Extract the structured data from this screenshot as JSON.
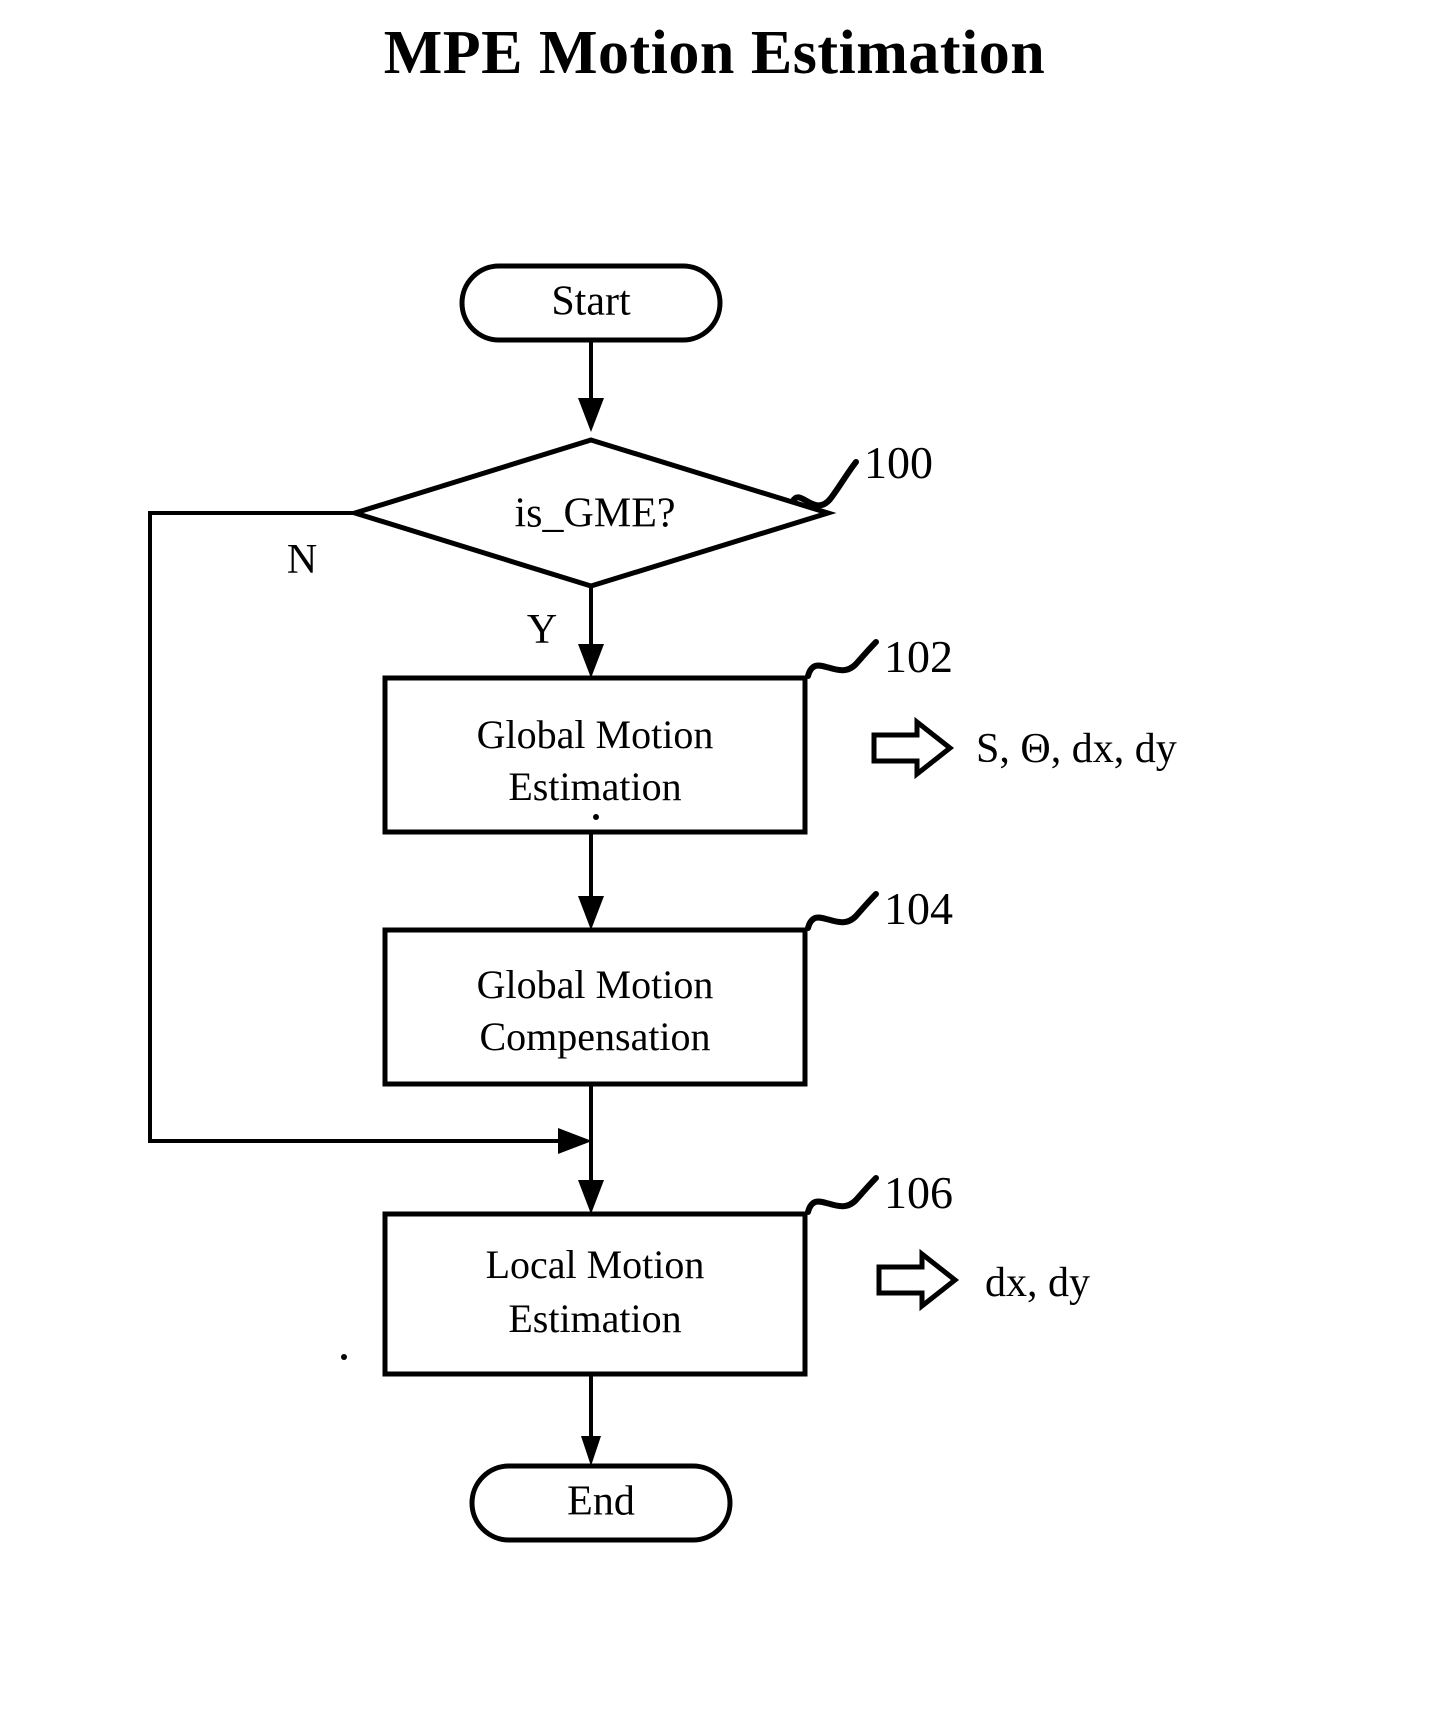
{
  "document": {
    "title": "MPE Motion Estimation"
  },
  "chart_data": {
    "type": "diagram",
    "diagram_kind": "flowchart",
    "title": "MPE Motion Estimation",
    "nodes": [
      {
        "id": "start",
        "shape": "stadium",
        "label": "Start",
        "ref": null
      },
      {
        "id": "is_gme",
        "shape": "diamond",
        "label": "is_GME?",
        "ref": "100"
      },
      {
        "id": "gme",
        "shape": "rectangle",
        "label_line1": "Global Motion",
        "label_line2": "Estimation",
        "ref": "102",
        "output": "S, Θ, dx, dy"
      },
      {
        "id": "gmc",
        "shape": "rectangle",
        "label_line1": "Global Motion",
        "label_line2": "Compensation",
        "ref": "104",
        "output": null
      },
      {
        "id": "lme",
        "shape": "rectangle",
        "label_line1": "Local Motion",
        "label_line2": "Estimation",
        "ref": "106",
        "output": "dx, dy"
      },
      {
        "id": "end",
        "shape": "stadium",
        "label": "End",
        "ref": null
      }
    ],
    "edges": [
      {
        "from": "start",
        "to": "is_gme",
        "label": ""
      },
      {
        "from": "is_gme",
        "to": "gme",
        "label": "Y"
      },
      {
        "from": "is_gme",
        "to": "lme",
        "label": "N"
      },
      {
        "from": "gme",
        "to": "gmc",
        "label": ""
      },
      {
        "from": "gmc",
        "to": "lme",
        "label": ""
      },
      {
        "from": "lme",
        "to": "end",
        "label": ""
      }
    ]
  },
  "flowchart": {
    "start_label": "Start",
    "decision_label": "is_GME?",
    "decision_ref": "100",
    "branch_yes": "Y",
    "branch_no": "N",
    "box1_line1": "Global Motion",
    "box1_line2": "Estimation",
    "box1_ref": "102",
    "box1_output": "S, Θ, dx, dy",
    "box2_line1": "Global Motion",
    "box2_line2": "Compensation",
    "box2_ref": "104",
    "box3_line1": "Local Motion",
    "box3_line2": "Estimation",
    "box3_ref": "106",
    "box3_output": "dx, dy",
    "end_label": "End"
  },
  "colors": {
    "ink": "#000000",
    "paper": "#ffffff"
  }
}
